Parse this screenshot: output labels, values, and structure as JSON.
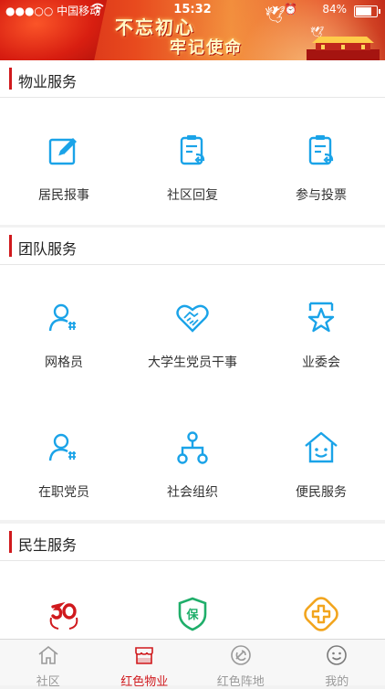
{
  "status_bar": {
    "carrier": "●●●○○ 中国移动",
    "time": "15:32",
    "battery_percent": "84%",
    "battery_level": 0.84
  },
  "banner": {
    "line1": "不忘初心",
    "line2": "牢记使命"
  },
  "sections": [
    {
      "title": "物业服务",
      "items": [
        {
          "label": "居民报事",
          "icon": "edit-icon"
        },
        {
          "label": "社区回复",
          "icon": "document-reply-icon"
        },
        {
          "label": "参与投票",
          "icon": "document-vote-icon"
        }
      ]
    },
    {
      "title": "团队服务",
      "items": [
        {
          "label": "网格员",
          "icon": "person-grid-icon"
        },
        {
          "label": "大学生党员干事",
          "icon": "heart-handshake-icon"
        },
        {
          "label": "业委会",
          "icon": "star-badge-icon"
        },
        {
          "label": "在职党员",
          "icon": "person-grid-icon"
        },
        {
          "label": "社会组织",
          "icon": "organization-icon"
        },
        {
          "label": "便民服务",
          "icon": "home-smile-icon"
        }
      ]
    },
    {
      "title": "民生服务",
      "items": [
        {
          "label": "",
          "icon": "pension-icon"
        },
        {
          "label": "",
          "icon": "insurance-shield-icon"
        },
        {
          "label": "",
          "icon": "medical-cross-icon"
        }
      ]
    }
  ],
  "tabbar": {
    "tabs": [
      {
        "label": "社区",
        "icon": "home-icon"
      },
      {
        "label": "红色物业",
        "icon": "store-icon"
      },
      {
        "label": "红色阵地",
        "icon": "party-emblem-icon"
      },
      {
        "label": "我的",
        "icon": "smile-icon"
      }
    ],
    "active_index": 1
  },
  "colors": {
    "accent": "#d0191d",
    "icon_blue": "#1aa3e8",
    "icon_green": "#1fae6a",
    "icon_orange": "#f2a51e"
  }
}
